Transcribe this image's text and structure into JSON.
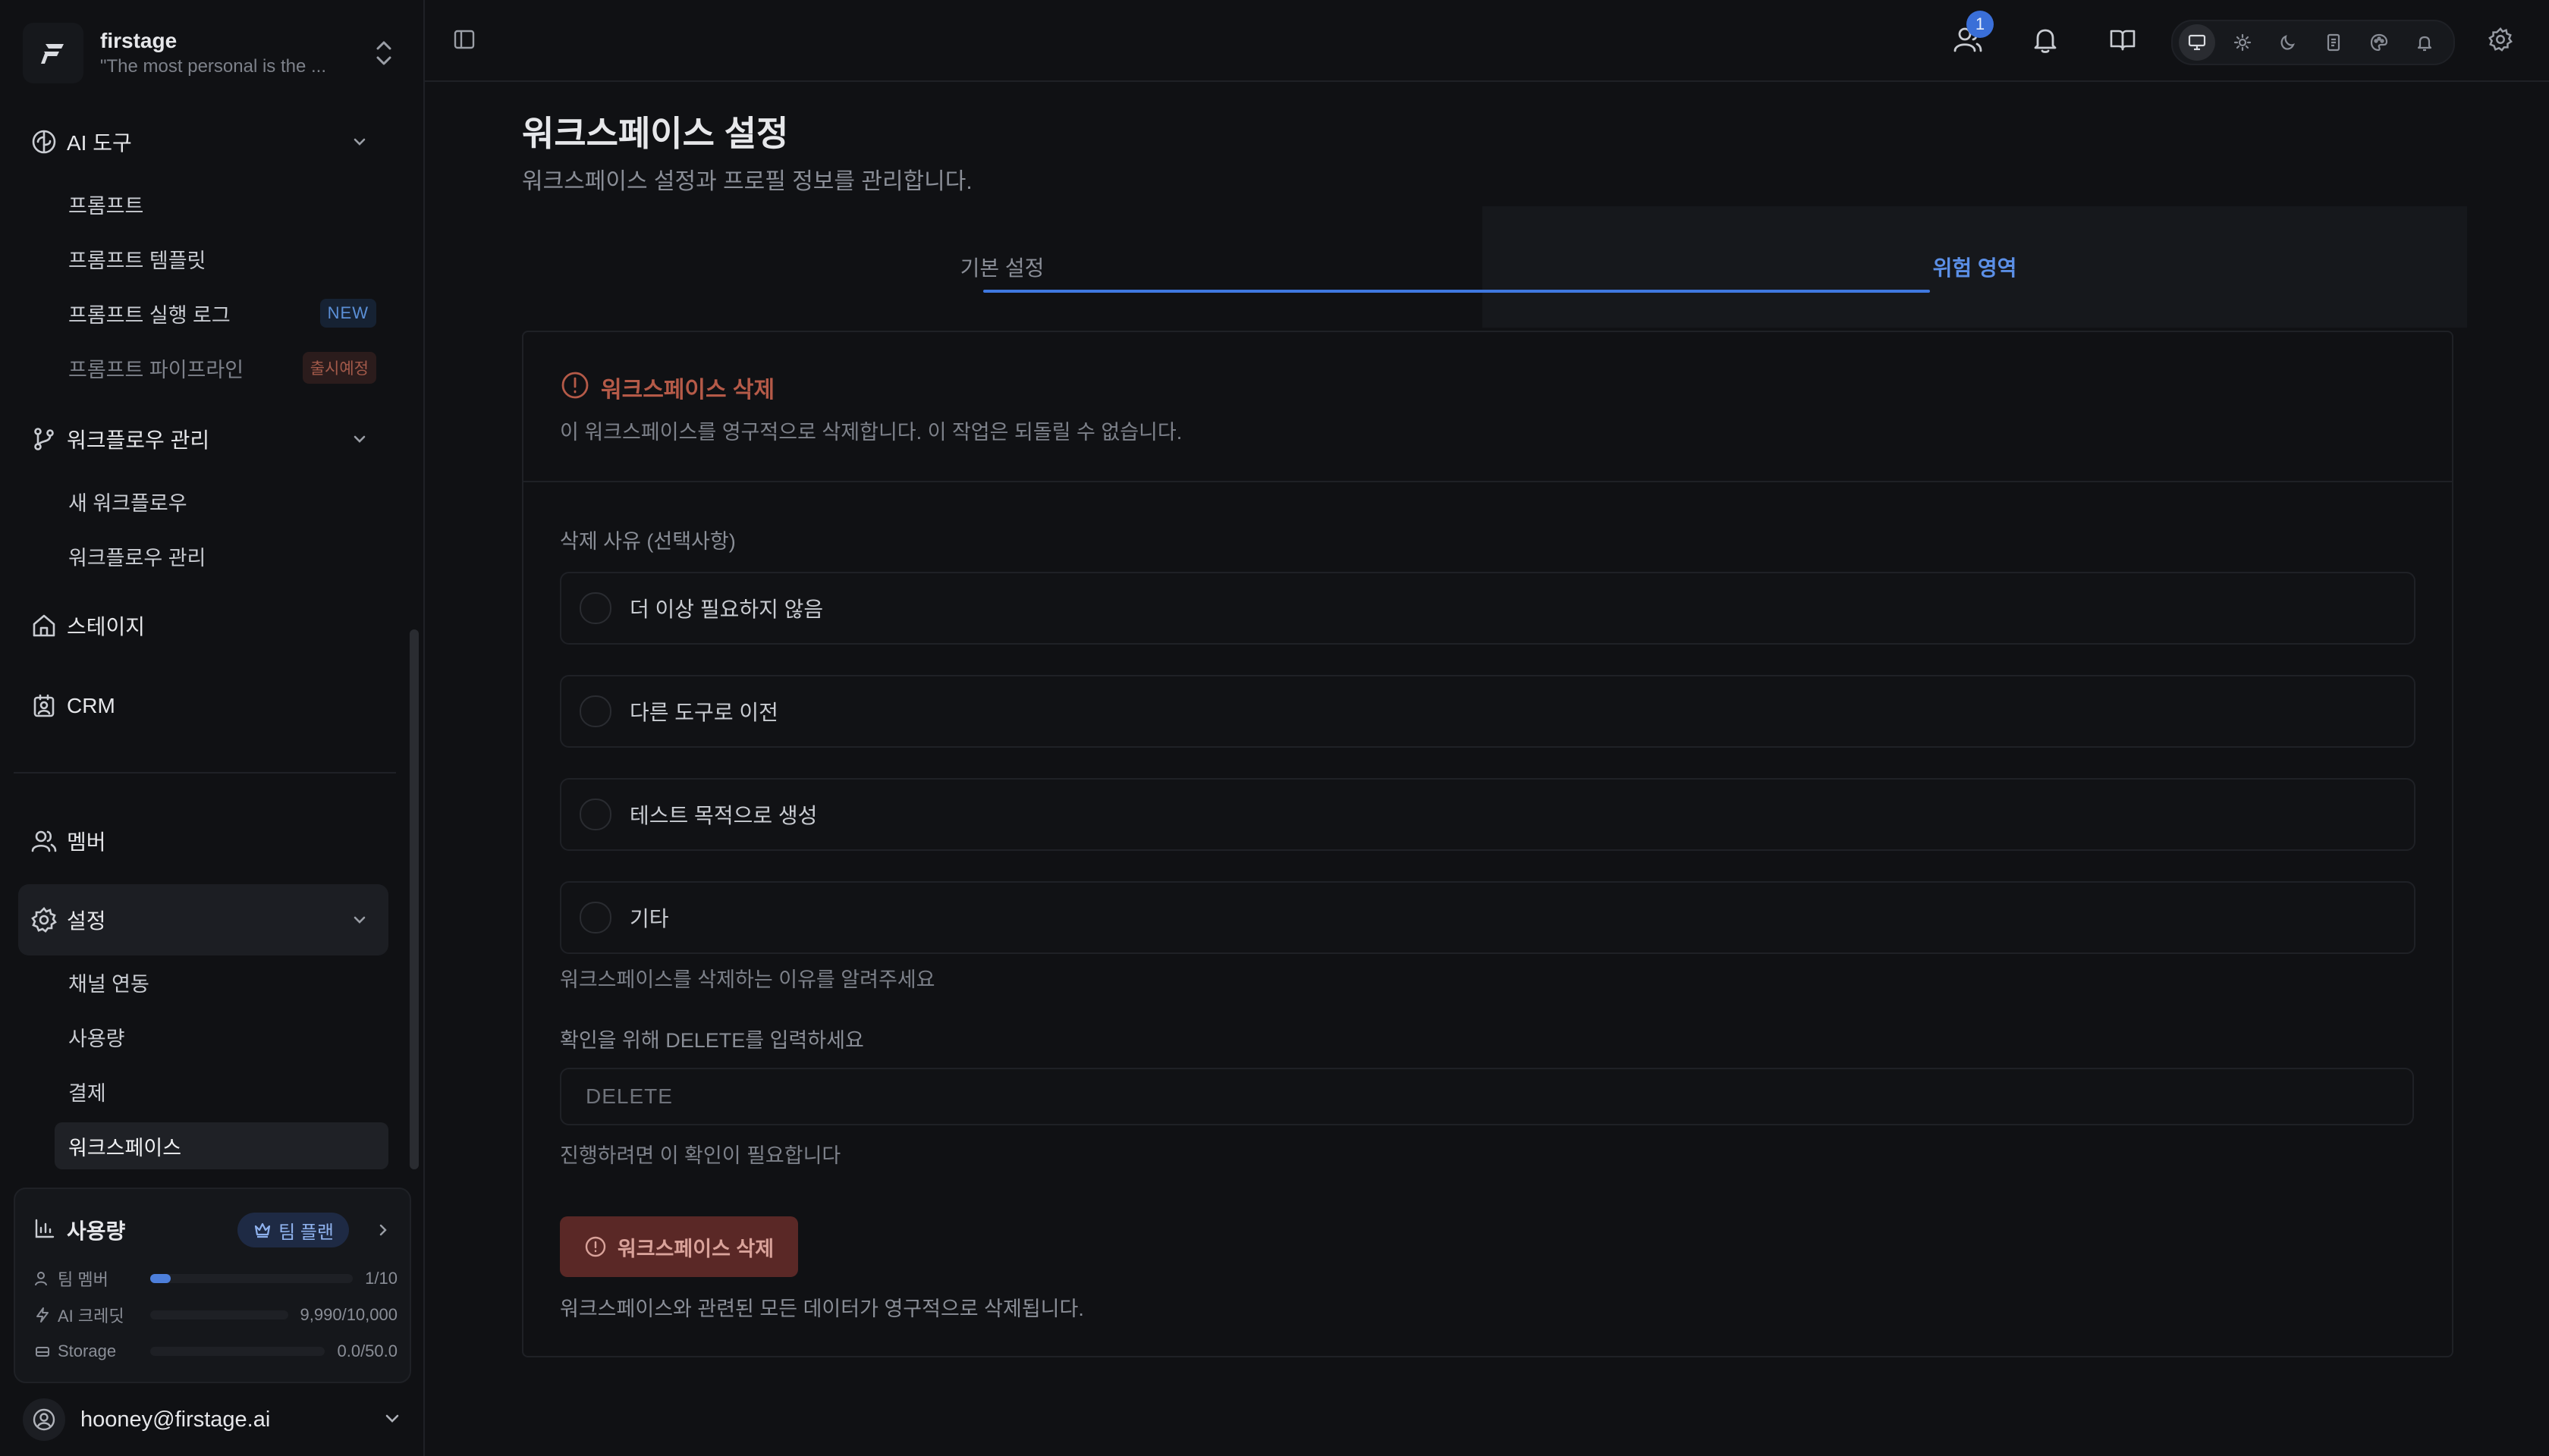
{
  "workspace": {
    "name": "firstage",
    "quote": "\"The most personal is the ..."
  },
  "sidebar": {
    "ai_tools": {
      "label": "AI 도구",
      "items": [
        {
          "label": "프롬프트"
        },
        {
          "label": "프롬프트 템플릿"
        },
        {
          "label": "프롬프트 실행 로그",
          "badge": "NEW"
        },
        {
          "label": "프롬프트 파이프라인",
          "badge": "출시예정"
        }
      ]
    },
    "workflow": {
      "label": "워크플로우 관리",
      "items": [
        {
          "label": "새 워크플로우"
        },
        {
          "label": "워크플로우 관리"
        }
      ]
    },
    "stage": {
      "label": "스테이지"
    },
    "crm": {
      "label": "CRM"
    },
    "members": {
      "label": "멤버"
    },
    "settings": {
      "label": "설정",
      "items": [
        {
          "label": "채널 연동"
        },
        {
          "label": "사용량"
        },
        {
          "label": "결제"
        },
        {
          "label": "워크스페이스"
        }
      ]
    }
  },
  "usage": {
    "title": "사용량",
    "plan": "팀 플랜",
    "rows": [
      {
        "label": "팀 멤버",
        "value": "1/10",
        "fraction": 0.1
      },
      {
        "label": "AI 크레딧",
        "value": "9,990/10,000",
        "fraction": 0.0
      },
      {
        "label": "Storage",
        "value": "0.0/50.0",
        "fraction": 0.0
      }
    ]
  },
  "user": {
    "email": "hooney@firstage.ai"
  },
  "topbar": {
    "notification_count": "1"
  },
  "page": {
    "title": "워크스페이스 설정",
    "subtitle": "워크스페이스 설정과 프로필 정보를 관리합니다.",
    "tabs": [
      {
        "label": "기본 설정"
      },
      {
        "label": "위험 영역"
      }
    ],
    "danger": {
      "title": "워크스페이스 삭제",
      "description": "이 워크스페이스를 영구적으로 삭제합니다. 이 작업은 되돌릴 수 없습니다.",
      "reason_label": "삭제 사유 (선택사항)",
      "reasons": [
        {
          "label": "더 이상 필요하지 않음"
        },
        {
          "label": "다른 도구로 이전"
        },
        {
          "label": "테스트 목적으로 생성"
        },
        {
          "label": "기타"
        }
      ],
      "reason_help": "워크스페이스를 삭제하는 이유를 알려주세요",
      "confirm_label": "확인을 위해 DELETE를 입력하세요",
      "confirm_placeholder": "DELETE",
      "confirm_help": "진행하려면 이 확인이 필요합니다",
      "delete_button": "워크스페이스 삭제",
      "delete_note": "워크스페이스와 관련된 모든 데이터가 영구적으로 삭제됩니다."
    }
  },
  "colors": {
    "accent": "#3f78e0",
    "danger": "#b55a48",
    "background": "#101114"
  }
}
